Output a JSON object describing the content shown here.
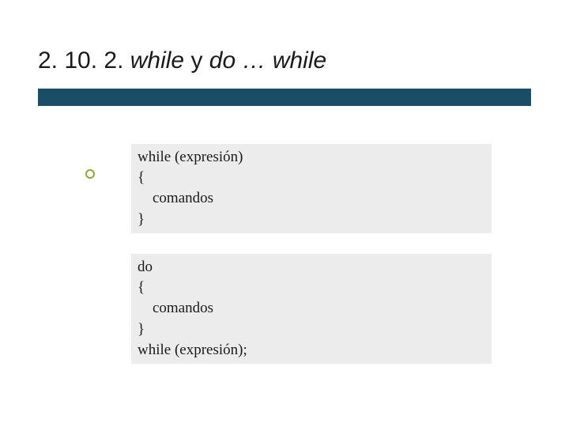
{
  "title": {
    "section_number": "2. 10. 2. ",
    "kw_while": "while ",
    "connector": "y ",
    "kw_do": "do … while"
  },
  "code": {
    "while_block": "while (expresión)\n{\n    comandos\n}",
    "do_while_block": "do\n{\n    comandos\n}\nwhile (expresión);"
  }
}
